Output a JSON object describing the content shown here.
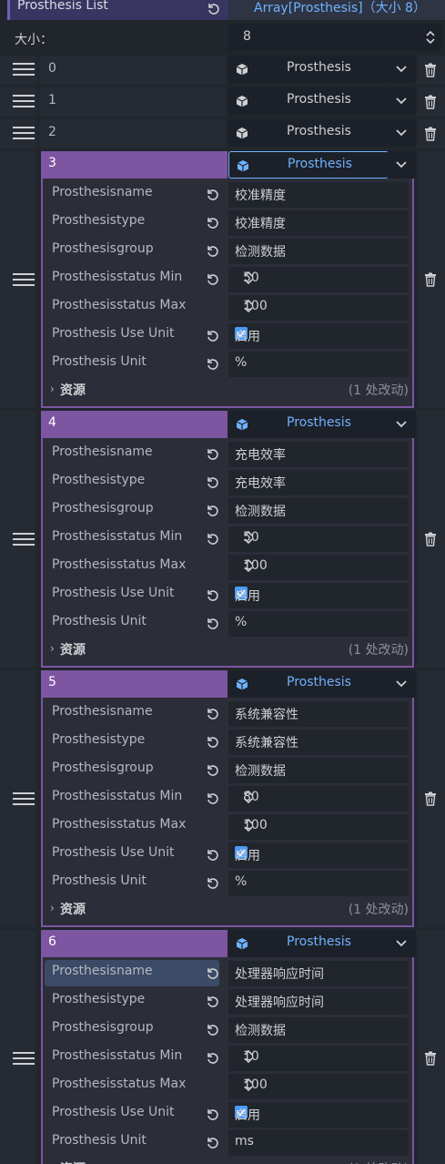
{
  "header": {
    "title": "Prosthesis List",
    "array_label": "Array[Prosthesis]（大小 8）"
  },
  "size": {
    "label": "大小：",
    "value": "8"
  },
  "collapsed_items": [
    {
      "index": "0",
      "resource": "Prosthesis"
    },
    {
      "index": "1",
      "resource": "Prosthesis"
    },
    {
      "index": "2",
      "resource": "Prosthesis"
    }
  ],
  "labels": {
    "name": "Prosthesisname",
    "type": "Prosthesistype",
    "group": "Prosthesisgroup",
    "min": "Prosthesisstatus Min",
    "max": "Prosthesisstatus Max",
    "use_unit": "Prosthesis Use Unit",
    "unit": "Prosthesis Unit",
    "enable": "启用",
    "resource": "资源",
    "changes": "(1 处改动)",
    "resource_type": "Prosthesis"
  },
  "items": [
    {
      "index": "3",
      "name": "校准精度",
      "type": "校准精度",
      "group": "检测数据",
      "min": "50",
      "max": "100",
      "unit": "%"
    },
    {
      "index": "4",
      "name": "充电效率",
      "type": "充电效率",
      "group": "检测数据",
      "min": "50",
      "max": "100",
      "unit": "%"
    },
    {
      "index": "5",
      "name": "系统兼容性",
      "type": "系统兼容性",
      "group": "检测数据",
      "min": "80",
      "max": "100",
      "unit": "%"
    },
    {
      "index": "6",
      "name": "处理器响应时间",
      "type": "处理器响应时间",
      "group": "检测数据",
      "min": "10",
      "max": "100",
      "unit": "ms"
    }
  ],
  "colors": {
    "accent_purple": "#7d55a0",
    "accent_blue": "#6fb2ff",
    "background": "#21252c"
  },
  "icons": [
    "revert-icon",
    "drag-handle-icon",
    "trash-icon",
    "resource-cube-icon",
    "chevron-down-icon",
    "spin-arrows-icon",
    "checkbox-checked-icon"
  ]
}
